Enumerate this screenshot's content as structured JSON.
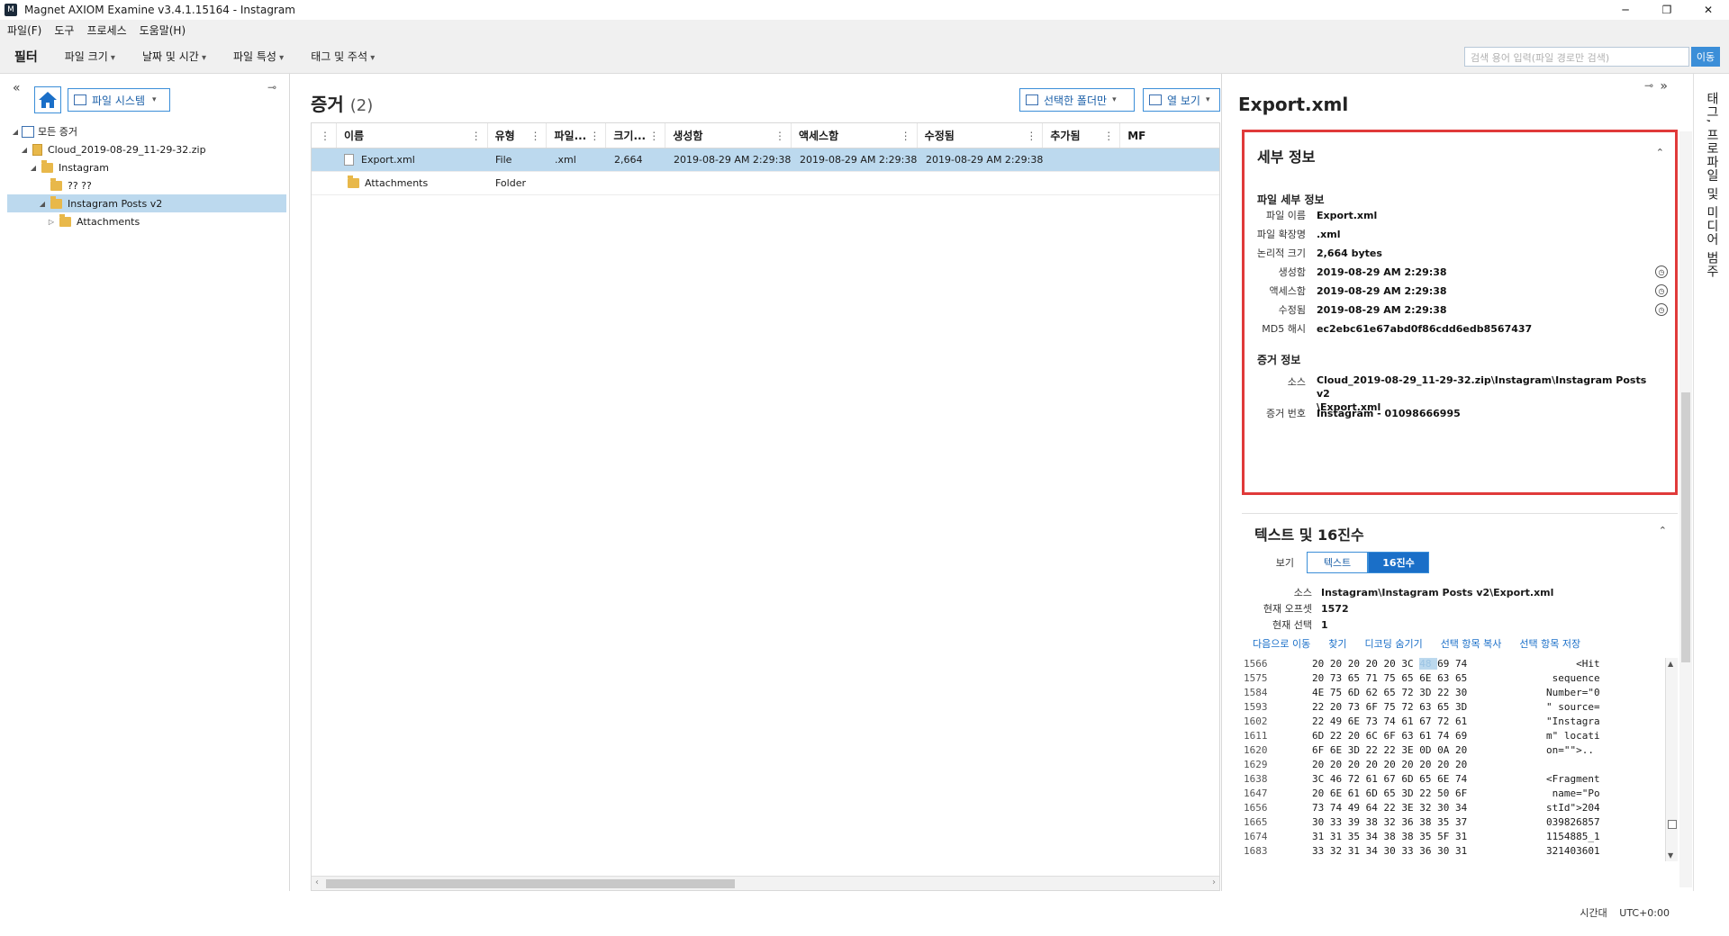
{
  "window": {
    "title": "Magnet AXIOM Examine v3.4.1.15164 - Instagram",
    "app_icon": "magnet-logo-icon",
    "buttons": [
      "─",
      "❐",
      "✕"
    ]
  },
  "menu": [
    "파일(F)",
    "도구",
    "프로세스",
    "도움말(H)"
  ],
  "filterbar": {
    "label": "필터",
    "filters": [
      "파일 크기",
      "날짜 및 시간",
      "파일 특성",
      "태그 및 주석"
    ],
    "search_placeholder": "검색 용어 입력(파일 경로만 검색)",
    "search_go": "이동"
  },
  "left": {
    "view_selector": "파일 시스템",
    "tree": [
      {
        "label": "모든 증거",
        "level": 0,
        "icon": "network-icon",
        "arrow": "◢"
      },
      {
        "label": "Cloud_2019-08-29_11-29-32.zip",
        "level": 1,
        "icon": "zip-icon",
        "arrow": "◢"
      },
      {
        "label": "Instagram",
        "level": 2,
        "icon": "folder-icon",
        "arrow": "◢"
      },
      {
        "label": "?? ??",
        "level": 3,
        "icon": "folder-icon",
        "arrow": ""
      },
      {
        "label": "Instagram Posts v2",
        "level": 3,
        "icon": "folder-icon",
        "arrow": "◢",
        "selected": true
      },
      {
        "label": "Attachments",
        "level": 4,
        "icon": "folder-icon",
        "arrow": "▷"
      }
    ]
  },
  "center": {
    "heading": "증거",
    "count": "(2)",
    "selected_folder_btn": "선택한 폴더만",
    "view_btn": "열 보기",
    "columns": [
      "이름",
      "유형",
      "파일...",
      "크기...",
      "생성함",
      "액세스함",
      "수정됨",
      "추가됨",
      "MF"
    ],
    "rows": [
      {
        "name": "Export.xml",
        "type": "File",
        "ext": ".xml",
        "size": "2,664",
        "created": "2019-08-29 AM 2:29:38",
        "accessed": "2019-08-29 AM 2:29:38",
        "modified": "2019-08-29 AM 2:29:38",
        "added": "",
        "mf": "",
        "icon": "file-icon",
        "selected": true
      },
      {
        "name": "Attachments",
        "type": "Folder",
        "ext": "",
        "size": "",
        "created": "",
        "accessed": "",
        "modified": "",
        "added": "",
        "mf": "",
        "icon": "folder-icon",
        "selected": false
      }
    ]
  },
  "details": {
    "doc_title": "Export.xml",
    "section_title": "세부 정보",
    "file_subhead": "파일 세부 정보",
    "file_rows": [
      {
        "label": "파일 이름",
        "value": "Export.xml",
        "clock": false
      },
      {
        "label": "파일 확장명",
        "value": ".xml",
        "clock": false
      },
      {
        "label": "논리적 크기",
        "value": "2,664 bytes",
        "clock": false
      },
      {
        "label": "생성함",
        "value": "2019-08-29 AM 2:29:38",
        "clock": true
      },
      {
        "label": "액세스함",
        "value": "2019-08-29 AM 2:29:38",
        "clock": true
      },
      {
        "label": "수정됨",
        "value": "2019-08-29 AM 2:29:38",
        "clock": true
      },
      {
        "label": "MD5 해시",
        "value": "ec2ebc61e67abd0f86cdd6edb8567437",
        "clock": false
      }
    ],
    "evidence_subhead": "증거 정보",
    "evidence_rows": [
      {
        "label": "소스",
        "value": "Cloud_2019-08-29_11-29-32.zip\\Instagram\\Instagram Posts v2\n\\Export.xml"
      },
      {
        "label": "증거 번호",
        "value": "Instagram - 01098666995"
      }
    ]
  },
  "hex": {
    "section_title": "텍스트 및 16진수",
    "view_label": "보기",
    "toggle_text": "텍스트",
    "toggle_hex": "16진수",
    "info": [
      {
        "label": "소스",
        "value": "Instagram\\Instagram Posts v2\\Export.xml"
      },
      {
        "label": "현재 오프셋",
        "value": "1572"
      },
      {
        "label": "현재 선택",
        "value": "1"
      }
    ],
    "actions": [
      "다음으로 이동",
      "찾기",
      "디코딩 숨기기",
      "선택 항목 복사",
      "선택 항목 저장"
    ],
    "lines": [
      {
        "off": "1566",
        "bytes": "20 20 20 20 20 3C 48 69 74",
        "ascii": "     <Hit"
      },
      {
        "off": "1575",
        "bytes": "20 73 65 71 75 65 6E 63 65",
        "ascii": " sequence"
      },
      {
        "off": "1584",
        "bytes": "4E 75 6D 62 65 72 3D 22 30",
        "ascii": "Number=\"0"
      },
      {
        "off": "1593",
        "bytes": "22 20 73 6F 75 72 63 65 3D",
        "ascii": "\" source="
      },
      {
        "off": "1602",
        "bytes": "22 49 6E 73 74 61 67 72 61",
        "ascii": "\"Instagra"
      },
      {
        "off": "1611",
        "bytes": "6D 22 20 6C 6F 63 61 74 69",
        "ascii": "m\" locati"
      },
      {
        "off": "1620",
        "bytes": "6F 6E 3D 22 22 3E 0D 0A 20",
        "ascii": "on=\"\">.. "
      },
      {
        "off": "1629",
        "bytes": "20 20 20 20 20 20 20 20 20",
        "ascii": "         "
      },
      {
        "off": "1638",
        "bytes": "3C 46 72 61 67 6D 65 6E 74",
        "ascii": "<Fragment"
      },
      {
        "off": "1647",
        "bytes": "20 6E 61 6D 65 3D 22 50 6F",
        "ascii": " name=\"Po"
      },
      {
        "off": "1656",
        "bytes": "73 74 49 64 22 3E 32 30 34",
        "ascii": "stId\">204"
      },
      {
        "off": "1665",
        "bytes": "30 33 39 38 32 36 38 35 37",
        "ascii": "039826857"
      },
      {
        "off": "1674",
        "bytes": "31 31 35 34 38 38 35 5F 31",
        "ascii": "1154885_1"
      },
      {
        "off": "1683",
        "bytes": "33 32 31 34 30 33 36 30 31",
        "ascii": "321403601"
      }
    ]
  },
  "side_tab": "태그, 프로파일 및 미디어 범주",
  "status": {
    "timezone_label": "시간대",
    "timezone": "UTC+0:00"
  },
  "colors": {
    "accent": "#3b8ed8",
    "selection": "#bcd9ee",
    "highlight_border": "#e03a3a"
  }
}
